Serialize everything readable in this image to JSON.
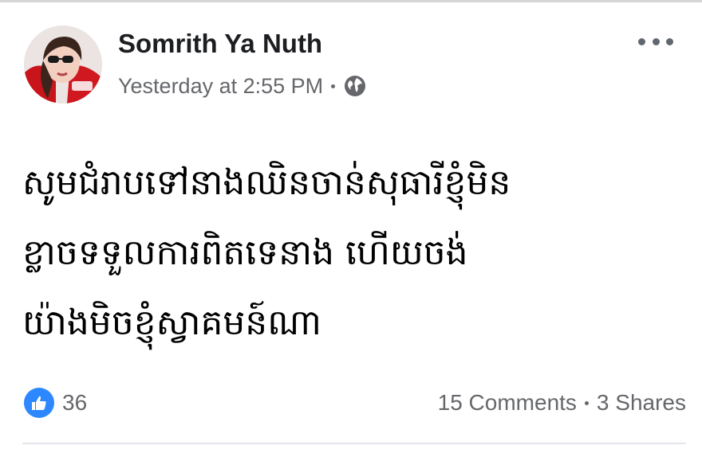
{
  "post": {
    "author": "Somrith Ya Nuth",
    "timestamp": "Yesterday at 2:55 PM",
    "privacy_icon": "globe-icon",
    "body_lines": [
      "សូមជំរាបទៅនាងឈិនចាន់សុធារីខ្ញុំមិន",
      "ខ្លាចទទួលការពិតទេនាង ហើយចង់",
      "យ៉ាងមិចខ្ញុំស្វាគមន៍ណា"
    ]
  },
  "stats": {
    "reaction_icon": "like-icon",
    "reaction_count": "36",
    "comments": "15 Comments",
    "shares": "3 Shares"
  },
  "colors": {
    "name": "#1c1e21",
    "meta": "#65676b",
    "like_blue": "#2d88ff"
  }
}
